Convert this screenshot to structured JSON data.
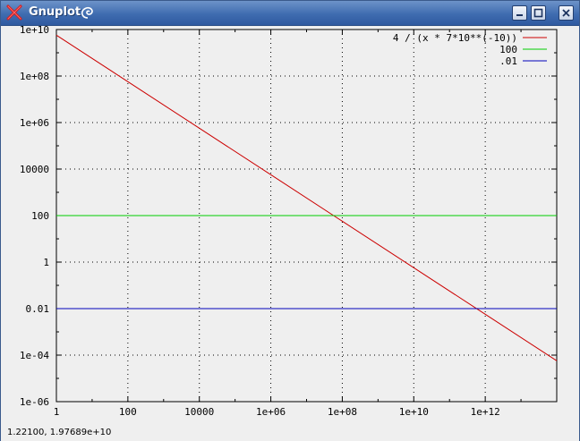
{
  "window": {
    "title": "Gnuplot"
  },
  "icons": {
    "app": "x-icon",
    "swirl": "swirl-icon",
    "minimize": "minimize-icon",
    "maximize": "maximize-icon",
    "close": "close-icon"
  },
  "status": {
    "coordinates": "1.22100,  1.97689e+10"
  },
  "chart_data": {
    "type": "line",
    "title": "",
    "xlabel": "",
    "ylabel": "",
    "x_scale": "log",
    "y_scale": "log",
    "xlim": [
      1,
      100000000000000
    ],
    "ylim": [
      1e-06,
      10000000000
    ],
    "grid": true,
    "legend_position": "top-right",
    "xticks": [
      1,
      100,
      10000,
      1000000,
      100000000,
      10000000000,
      1000000000000
    ],
    "xtick_labels": [
      "1",
      "100",
      "10000",
      "1e+06",
      "1e+08",
      "1e+10",
      "1e+12"
    ],
    "yticks": [
      1e-06,
      0.0001,
      0.01,
      1,
      100,
      10000,
      1000000,
      100000000,
      10000000000
    ],
    "ytick_labels": [
      "1e-06",
      "1e-04",
      "0.01",
      "1",
      "100",
      "10000",
      "1e+06",
      "1e+08",
      "1e+10"
    ],
    "series": [
      {
        "name": "4 / (x * 7*10**(-10))",
        "color": "#cc0000",
        "x": [
          1,
          100,
          10000,
          1000000,
          100000000,
          10000000000,
          1000000000000,
          100000000000000
        ],
        "y": [
          5714285714,
          57142857,
          571429,
          5714,
          57.14,
          0.5714,
          0.005714,
          5.714e-05
        ]
      },
      {
        "name": "100",
        "color": "#00cc00",
        "x": [
          1,
          100000000000000
        ],
        "y": [
          100,
          100
        ]
      },
      {
        "name": ".01",
        "color": "#0000bb",
        "x": [
          1,
          100000000000000
        ],
        "y": [
          0.01,
          0.01
        ]
      }
    ]
  }
}
